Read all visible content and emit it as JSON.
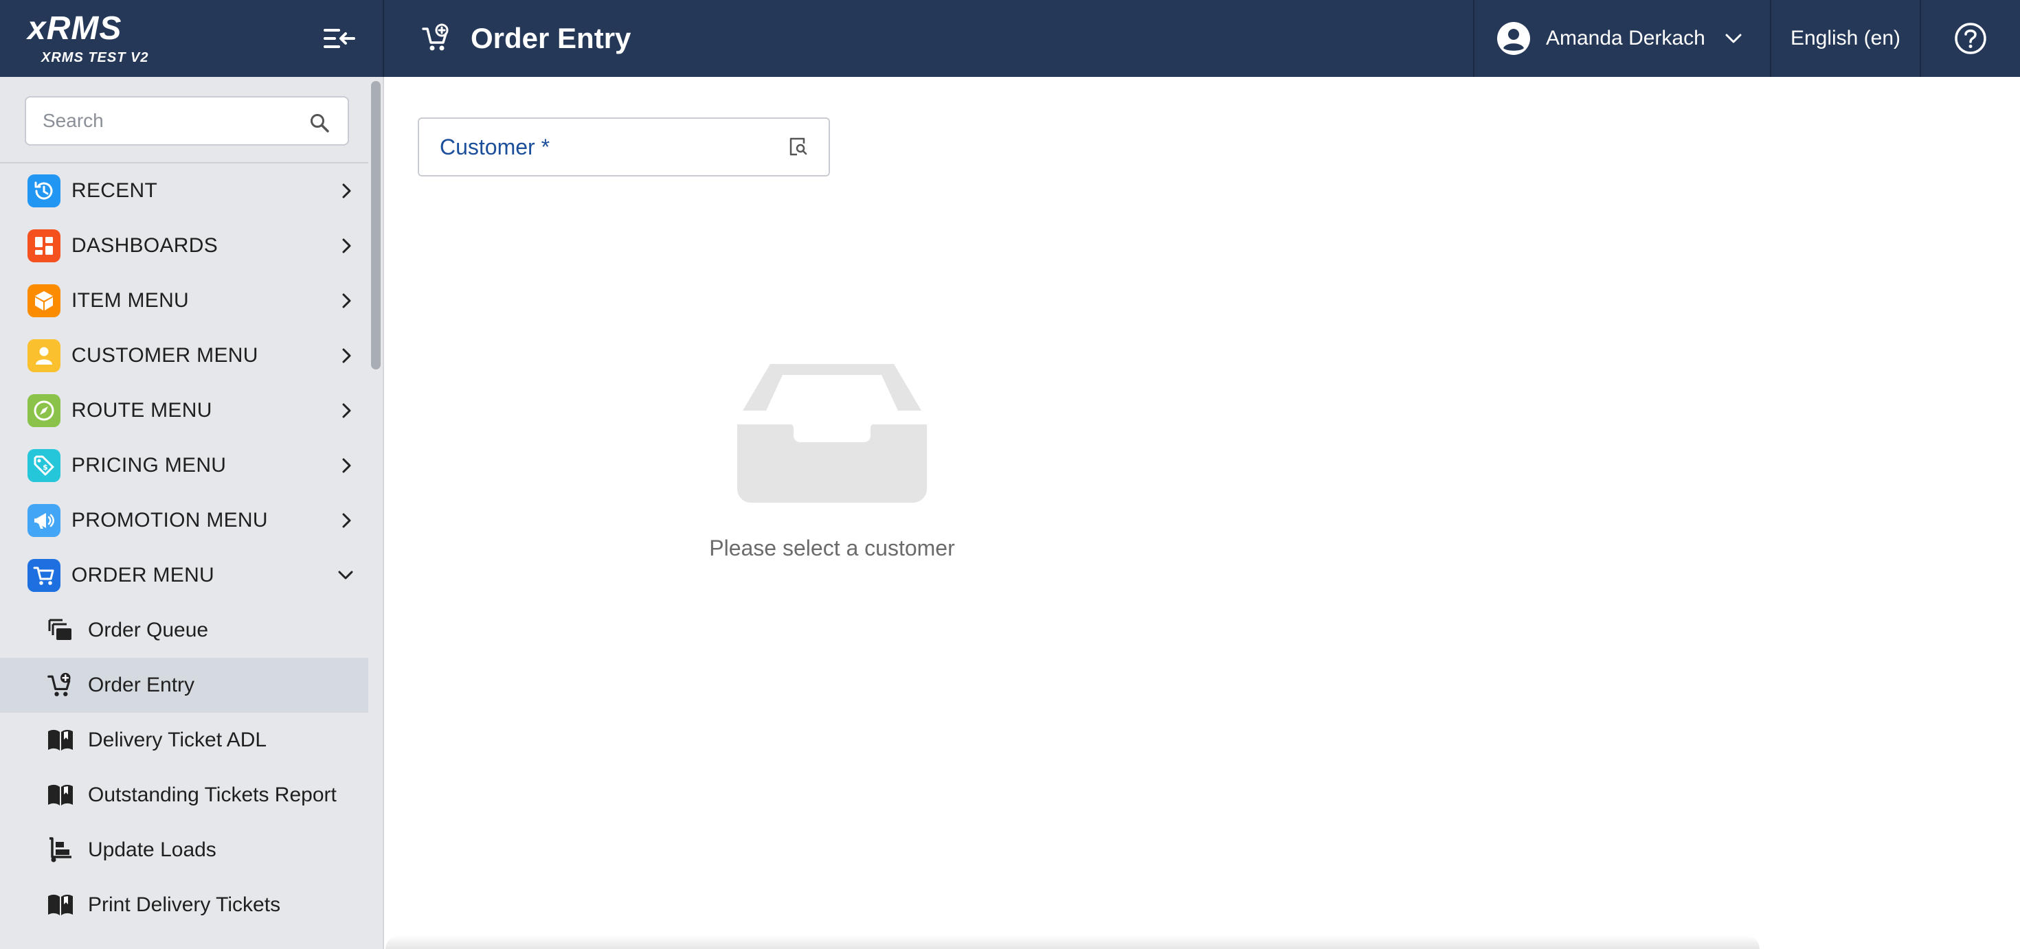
{
  "app": {
    "brand": "xRMS",
    "environment": "XRMS TEST V2",
    "page_title": "Order Entry"
  },
  "header": {
    "user_name": "Amanda Derkach",
    "language": "English (en)"
  },
  "sidebar": {
    "search_placeholder": "Search",
    "items": [
      {
        "label": "RECENT",
        "icon": "history-icon",
        "color": "#2196f3"
      },
      {
        "label": "DASHBOARDS",
        "icon": "dashboard-icon",
        "color": "#f4511e"
      },
      {
        "label": "ITEM MENU",
        "icon": "box-icon",
        "color": "#fb8c00"
      },
      {
        "label": "CUSTOMER MENU",
        "icon": "person-icon",
        "color": "#fbc02d"
      },
      {
        "label": "ROUTE MENU",
        "icon": "compass-icon",
        "color": "#8bc34a"
      },
      {
        "label": "PRICING MENU",
        "icon": "price-tag-icon",
        "color": "#26c6da"
      },
      {
        "label": "PROMOTION MENU",
        "icon": "megaphone-icon",
        "color": "#42a5f5"
      },
      {
        "label": "ORDER MENU",
        "icon": "cart-icon",
        "color": "#1e6fe0"
      }
    ],
    "order_menu_children": [
      {
        "label": "Order Queue",
        "icon": "queue-icon"
      },
      {
        "label": "Order Entry",
        "icon": "cart-add-icon",
        "active": true
      },
      {
        "label": "Delivery Ticket ADL",
        "icon": "book-icon"
      },
      {
        "label": "Outstanding Tickets Report",
        "icon": "book-icon"
      },
      {
        "label": "Update Loads",
        "icon": "dolly-icon"
      },
      {
        "label": "Print Delivery Tickets",
        "icon": "book-icon"
      }
    ]
  },
  "main": {
    "customer_label": "Customer *",
    "empty_message": "Please select a customer"
  },
  "colors": {
    "topbar": "#253858",
    "sidebar": "#e5e7eb",
    "active_item": "#d5d9e0",
    "link_blue": "#1b4f9c"
  }
}
